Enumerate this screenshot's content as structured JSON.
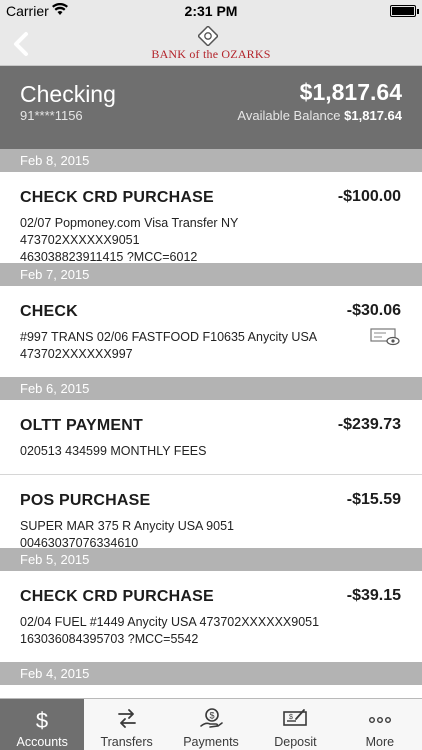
{
  "status_bar": {
    "carrier": "Carrier",
    "time": "2:31 PM"
  },
  "nav": {
    "logo_text": "BANK of the OZARKS"
  },
  "account": {
    "name": "Checking",
    "number": "91****1156",
    "balance": "$1,817.64",
    "available_label": "Available Balance",
    "available_value": "$1,817.64"
  },
  "dates": [
    "Feb 8, 2015",
    "Feb 7, 2015",
    "Feb 6, 2015",
    "Feb 5, 2015",
    "Feb 4, 2015"
  ],
  "transactions": [
    {
      "title": "CHECK CRD PURCHASE",
      "amount": "-$100.00",
      "line1": "02/07 Popmoney.com Visa Transfer NY 473702XXXXXX9051",
      "line2": "463038823911415 ?MCC=6012"
    },
    {
      "title": "CHECK",
      "amount": "-$30.06",
      "line1": "#997 TRANS 02/06 FASTFOOD F10635 Anycity USA",
      "line2": "473702XXXXXX997"
    },
    {
      "title": "OLTT PAYMENT",
      "amount": "-$239.73",
      "line1": "020513 434599 MONTHLY FEES",
      "line2": ""
    },
    {
      "title": "POS PURCHASE",
      "amount": "-$15.59",
      "line1": "SUPER MAR 375 R Anycity USA 9051 00463037076334610",
      "line2": ""
    },
    {
      "title": "CHECK CRD PURCHASE",
      "amount": "-$39.15",
      "line1": "02/04 FUEL #1449 Anycity USA 473702XXXXXX9051",
      "line2": "163036084395703 ?MCC=5542"
    }
  ],
  "tabs": [
    {
      "label": "Accounts",
      "icon": "dollar-icon"
    },
    {
      "label": "Transfers",
      "icon": "transfer-arrows-icon"
    },
    {
      "label": "Payments",
      "icon": "payment-hand-icon"
    },
    {
      "label": "Deposit",
      "icon": "check-deposit-icon"
    },
    {
      "label": "More",
      "icon": "more-dots-icon"
    }
  ],
  "colors": {
    "header_bg": "#6f6f6f",
    "date_bg": "#b3b3b3",
    "brand_red": "#b3232a",
    "active_tab": "#6f6f6f"
  }
}
